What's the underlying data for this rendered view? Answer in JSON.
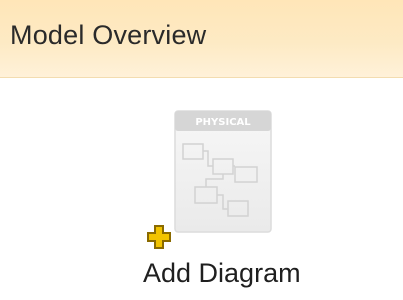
{
  "header": {
    "title": "Model Overview"
  },
  "add_diagram": {
    "label": "Add Diagram",
    "icon_badge": "PHYSICAL",
    "icon": "physical-diagram-icon",
    "overlay_icon": "plus-icon"
  },
  "colors": {
    "header_bg": "#fdeac4",
    "plus_fill": "#f2c300",
    "plus_stroke": "#8a6a00"
  }
}
